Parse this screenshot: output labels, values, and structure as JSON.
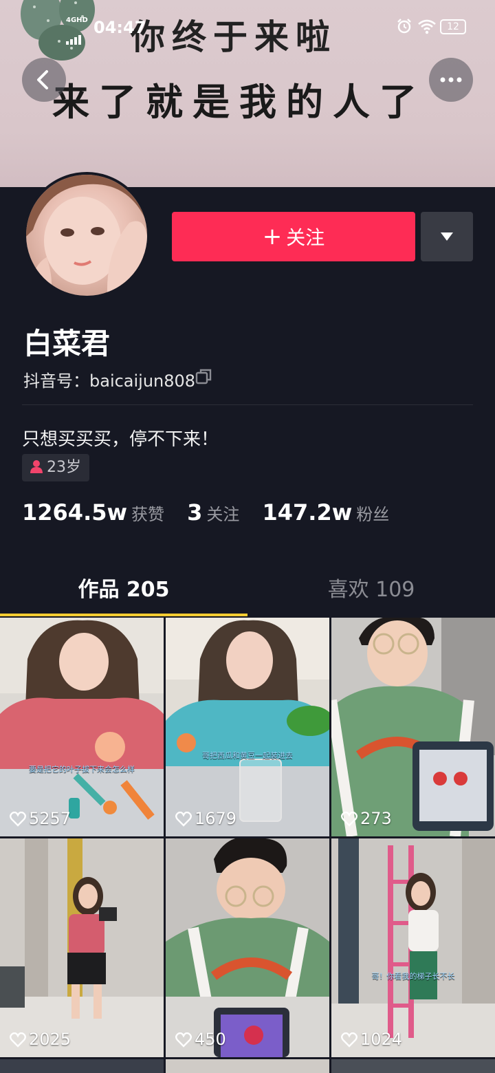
{
  "status_bar": {
    "network": "4GHD",
    "time": "04:47",
    "battery": "12"
  },
  "banner": {
    "line1": "你终于来啦",
    "line2": "来了就是我的人了"
  },
  "profile": {
    "follow_label": "关注",
    "nickname": "白菜君",
    "account": "抖音号：baicaijun808",
    "bio": "只想买买买，停不下来！",
    "age": "23岁"
  },
  "stats": [
    {
      "value": "1264.5w",
      "label": "获赞"
    },
    {
      "value": "3",
      "label": "关注"
    },
    {
      "value": "147.2w",
      "label": "粉丝"
    }
  ],
  "tabs": {
    "works": "作品 205",
    "likes": "喜欢 109"
  },
  "videos": [
    {
      "likes": "5257",
      "caption": "要是把它的叶子拔下来会怎么样"
    },
    {
      "likes": "1679",
      "caption": "哥把西瓜和黄豆一起装进去"
    },
    {
      "likes": "273",
      "caption": ""
    },
    {
      "likes": "2025",
      "caption": ""
    },
    {
      "likes": "450",
      "caption": ""
    },
    {
      "likes": "1024",
      "caption": "哥！你看我的梯子长不长"
    }
  ],
  "colors": {
    "background": "#161823",
    "follow": "#fe2c55",
    "tab_indicator": "#facd32"
  }
}
